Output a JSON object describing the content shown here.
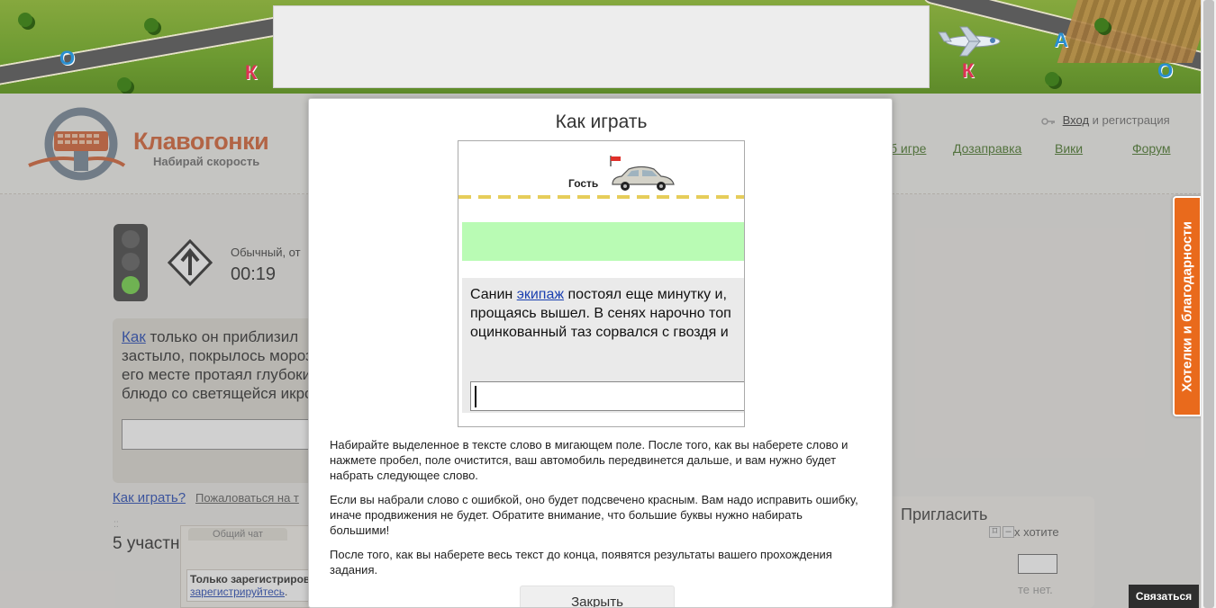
{
  "banner": {
    "letters": [
      "О",
      "К",
      "А",
      "К",
      "О"
    ]
  },
  "header": {
    "brand_name": "Клавогонки",
    "tagline": "Набирай скорость",
    "login_link": "Вход",
    "login_suffix": "и регистрация",
    "nav": {
      "partial": "б игре",
      "refuel": "Дозаправка",
      "wiki": "Вики",
      "forum": "Форум"
    }
  },
  "game": {
    "mode": "Обычный, от",
    "timer": "00:19",
    "text_lines": [
      "только он приблизил",
      "застыло, покрылось мороз",
      "его месте протаял глубоки",
      "блюдо со светящейся икро"
    ],
    "highlight_word": "Как",
    "help_link": "Как играть?",
    "complain_link": "Пожаловаться на т",
    "participants": "5 участн",
    "chat": {
      "tab": "Общий чат",
      "msg_bold": "Только зарегистриров",
      "msg_link": "зарегистрируйтесь",
      "msg_tail": "."
    },
    "invite": {
      "title": "Пригласить",
      "hint": "х хотите",
      "note": "те нет."
    }
  },
  "modal": {
    "title": "Как играть",
    "demo": {
      "guest_label": "Гость",
      "line1_before": "Санин ",
      "line1_link": "экипаж",
      "line1_after": " постоял еще минутку и,",
      "line2": "прощаясь вышел. В сенях нарочно топ",
      "line3": "оцинкованный таз сорвался с гвоздя и"
    },
    "paragraphs": [
      "Набирайте выделенное в тексте слово в мигающем поле. После того, как вы наберете слово и нажмете пробел, поле очистится, ваш автомобиль передвинется дальше, и вам нужно будет набрать следующее слово.",
      "Если вы набрали слово с ошибкой, оно будет подсвечено красным. Вам надо исправить ошибку, иначе продвижения не будет. Обратите внимание, что большие буквы нужно набирать большими!",
      "После того, как вы наберете весь текст до конца, появятся результаты вашего прохождения задания."
    ],
    "close_button": "Закрыть"
  },
  "side_tab": "Хотелки и благодарности",
  "contact_button": "Связаться",
  "colors": {
    "accent_orange": "#e96a1c",
    "brand_orange": "#d25a2a",
    "link_green": "#3e6f1e",
    "link_blue": "#1a3fb0",
    "demo_green": "#b9fbb4"
  }
}
